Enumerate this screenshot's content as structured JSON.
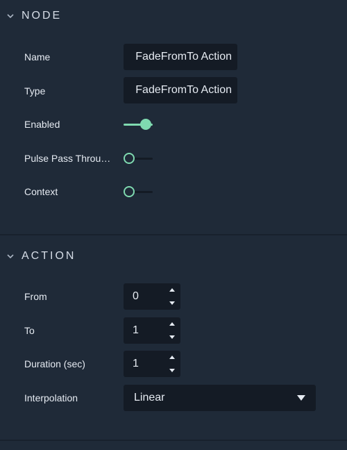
{
  "colors": {
    "background": "#1f2a38",
    "field_background": "#141b25",
    "accent": "#7fdab0",
    "toggle_off_track": "#141b25"
  },
  "node": {
    "title": "NODE",
    "expanded": true,
    "fields": {
      "name_label": "Name",
      "name_value": "FadeFromTo Action",
      "type_label": "Type",
      "type_value": "FadeFromTo Action",
      "enabled_label": "Enabled",
      "enabled": true,
      "pulse_label": "Pulse Pass Throu…",
      "pulse": false,
      "context_label": "Context",
      "context": false
    }
  },
  "action": {
    "title": "ACTION",
    "expanded": true,
    "fields": {
      "from_label": "From",
      "from_value": "0",
      "to_label": "To",
      "to_value": "1",
      "duration_label": "Duration (sec)",
      "duration_value": "1",
      "interpolation_label": "Interpolation",
      "interpolation_value": "Linear"
    }
  }
}
